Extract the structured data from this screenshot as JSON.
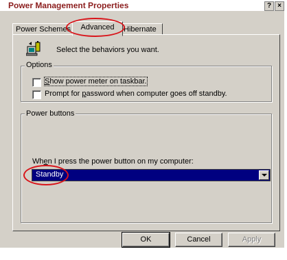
{
  "window": {
    "title": "Power Management Properties",
    "help_label": "?",
    "close_label": "×"
  },
  "tabs": [
    {
      "label": "Power Schemes",
      "active": false
    },
    {
      "label": "Advanced",
      "active": true
    },
    {
      "label": "Hibernate",
      "active": false
    }
  ],
  "header": {
    "icon": "battery-computer-icon",
    "text": "Select the behaviors you want."
  },
  "options": {
    "legend": "Options",
    "show_meter": {
      "pre": "",
      "accel": "S",
      "post": "how power meter on taskbar.",
      "checked": false
    },
    "prompt_password": {
      "pre": "Prompt for ",
      "accel": "p",
      "post": "assword when computer goes off standby.",
      "checked": false
    }
  },
  "power_buttons": {
    "legend": "Power buttons",
    "prompt": {
      "pre": "Wh",
      "accel": "e",
      "post": "n I press the power button on my computer:"
    },
    "selected": "Standby"
  },
  "buttons": {
    "ok": "OK",
    "cancel": "Cancel",
    "apply": "Apply"
  },
  "annotations": {
    "color": "#d9141a"
  }
}
